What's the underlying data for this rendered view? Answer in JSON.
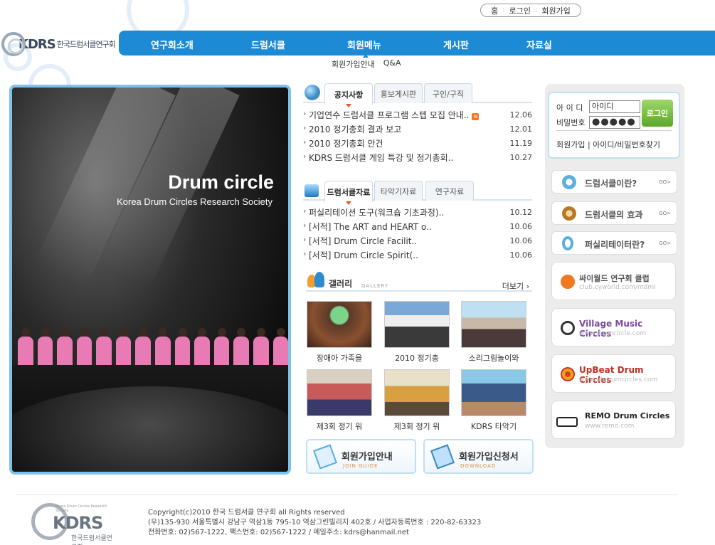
{
  "top_links": [
    "홈",
    "로그인",
    "회원가입"
  ],
  "logo": {
    "brand": "KDRS",
    "korean": "한국드럼서클연구회",
    "english": "Korea Drum Circles Research Society"
  },
  "nav": [
    "연구회소개",
    "드럼서클",
    "회원메뉴",
    "게시판",
    "자료실"
  ],
  "subnav": [
    "회원가입안내",
    "Q&A"
  ],
  "hero": {
    "title": "Drum circle",
    "subtitle": "Korea Drum Circles Research Society"
  },
  "notice_board": {
    "tabs": [
      "공지사항",
      "홍보게시판",
      "구인/구직"
    ],
    "items": [
      {
        "title": "기업연수 드럼서클 프로그램 스텝 모집 안내..",
        "date": "12.06",
        "new": true
      },
      {
        "title": "2010 정기총회 결과 보고",
        "date": "12.01"
      },
      {
        "title": "2010 정기총회 안건",
        "date": "11.19"
      },
      {
        "title": "KDRS 드럼서클 게임 특강 및 정기총회..",
        "date": "10.27"
      }
    ]
  },
  "data_board": {
    "tabs": [
      "드럼서클자료",
      "타악기자료",
      "연구자료"
    ],
    "items": [
      {
        "title": "퍼실리테이션 도구(워크숍 기초과정)..",
        "date": "10.12"
      },
      {
        "title": "[서적] The ART and HEART o..",
        "date": "10.06"
      },
      {
        "title": "[서적] Drum Circle Facilit..",
        "date": "10.06"
      },
      {
        "title": "[서적] Drum Circle Spirit(..",
        "date": "10.06"
      }
    ]
  },
  "gallery": {
    "title": "갤러리",
    "subtitle": "GALLERY",
    "more": "더보기 ›",
    "items": [
      "장애아 가족을",
      "2010 정기총",
      "소리그림놀이와",
      "제3회 정기 워",
      "제3회 정기 워",
      "KDRS 타악기"
    ]
  },
  "bottom_buttons": [
    {
      "title": "회원가입안내",
      "sub": "JOIN GUIDE"
    },
    {
      "title": "회원가입신청서",
      "sub": "DOWNLOAD"
    }
  ],
  "login": {
    "id_label": "아 이 디",
    "pw_label": "비밀번호",
    "id_value": "아이디",
    "pw_value": "●●●●●",
    "button": "로그인",
    "links": "회원가입 | 아이디/비밀번호찾기"
  },
  "quick_links": [
    {
      "title": "드럼서클이란?",
      "go": "GO>"
    },
    {
      "title": "드럼서클의 효과",
      "go": "GO>"
    },
    {
      "title": "퍼실리테이터란?",
      "go": "GO>"
    }
  ],
  "banners": [
    {
      "title": "싸이월드 연구회 클럽",
      "url": "club.cyworld.com/mdmi"
    },
    {
      "title": "Village Music Circles",
      "url": "www.drumcircle.com"
    },
    {
      "title": "UpBeat Drum Circles",
      "url": "www.ubdrumcircles.com"
    },
    {
      "title": "REMO Drum Circles",
      "url": "www.remo.com"
    }
  ],
  "footer": {
    "copyright": "Copyright(c)2010 한국 드럼서클 연구회 all Rights reserved",
    "address": "(우)135-930 서울특별시 강남구 역삼1동 795-10 역삼그린빌리지 402호 / 사업자등록번호 : 220-82-63323",
    "contact": "전화번호: 02)567-1222, 팩스번호: 02)567-1222 /  메일주소: kdrs@hanmail.net"
  },
  "colors": {
    "nav": "#1d8ad5",
    "accent_orange": "#e45a20",
    "login_green": "#5aa82a"
  }
}
